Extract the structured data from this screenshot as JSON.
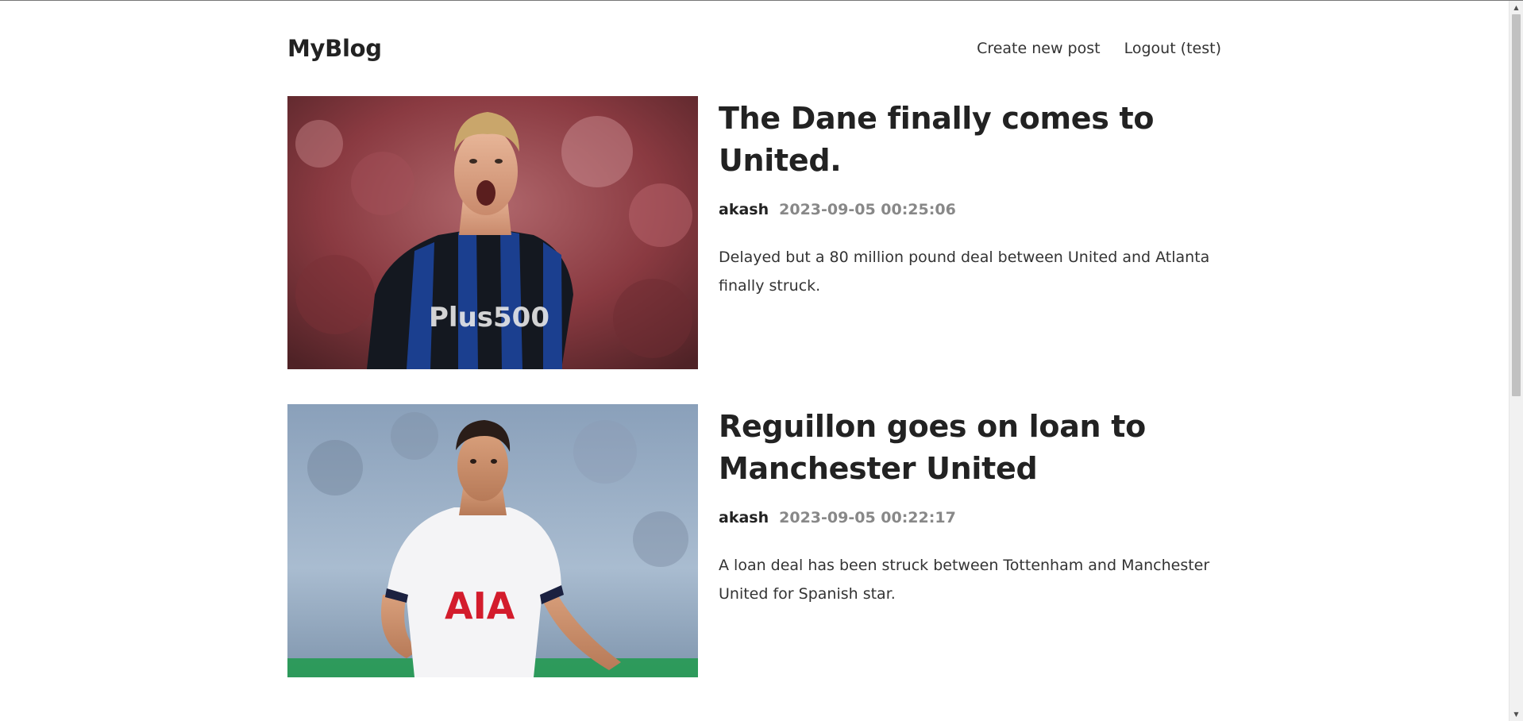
{
  "header": {
    "logo": "MyBlog",
    "nav": [
      {
        "label": "Create new post"
      },
      {
        "label": "Logout (test)"
      }
    ]
  },
  "posts": [
    {
      "title": "The Dane finally comes to United.",
      "author": "akash",
      "time": "2023-09-05 00:25:06",
      "summary": "Delayed but a 80 million pound deal between United and Atlanta finally struck.",
      "image_alt": "Footballer in black and blue striped Atalanta kit shouting",
      "image_text": "Plus500"
    },
    {
      "title": "Reguillon goes on loan to Manchester United",
      "author": "akash",
      "time": "2023-09-05 00:22:17",
      "summary": "A loan deal has been struck between Tottenham and Manchester United for Spanish star.",
      "image_alt": "Footballer in white Tottenham kit running",
      "image_text": "AIA"
    }
  ],
  "colors": {
    "text": "#222222",
    "muted": "#888888",
    "atalanta_blue": "#1b3f8f",
    "stadium_red": "#8a2a30",
    "stadium_blue": "#a9bcd0",
    "aia_red": "#d31c2c"
  }
}
